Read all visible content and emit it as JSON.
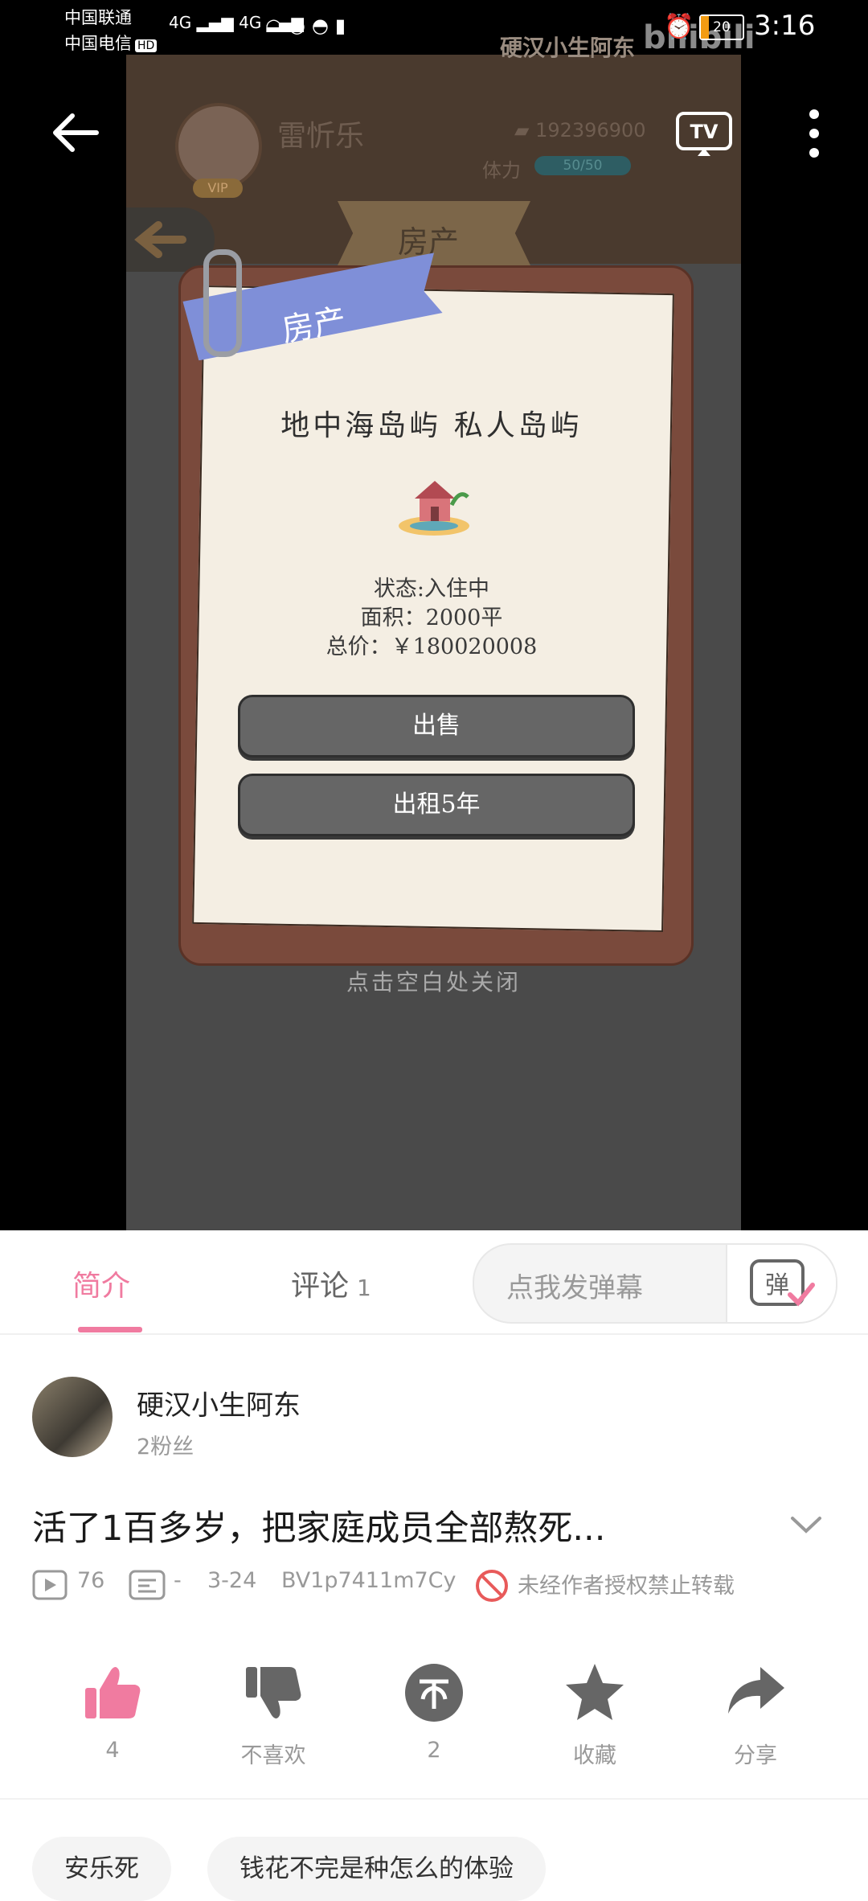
{
  "status_bar": {
    "carrier1": "中国联通",
    "carrier2": "中国电信",
    "hd": "HD",
    "network": "4G",
    "battery": "20",
    "time": "3:16"
  },
  "video": {
    "watermark_uploader": "硬汉小生阿东",
    "watermark_logo": "bilibili",
    "game": {
      "player_name": "雷忻乐",
      "vip": "VIP",
      "coins": "192396900",
      "stamina_label": "体力",
      "stamina_value": "50/50",
      "banner": "房产",
      "dialog": {
        "tag": "房产",
        "property_title": "地中海岛屿 私人岛屿",
        "status": "状态:入住中",
        "area": "面积：2000平",
        "price": "总价：￥180020008",
        "sell_button": "出售",
        "rent_button": "出租5年",
        "close_hint": "点击空白处关闭"
      }
    }
  },
  "tabs": {
    "intro": "简介",
    "comments": "评论",
    "comments_count": "1",
    "danmaku_placeholder": "点我发弹幕",
    "danmaku_button": "弹"
  },
  "uploader": {
    "name": "硬汉小生阿东",
    "fans": "2粉丝"
  },
  "video_info": {
    "title": "活了1百多岁，把家庭成员全部熬死...",
    "plays": "76",
    "danmaku_count": "-",
    "date": "3-24",
    "bvid": "BV1p7411m7Cy",
    "no_repost": "未经作者授权禁止转载"
  },
  "actions": {
    "like": "4",
    "dislike": "不喜欢",
    "coin": "2",
    "favorite": "收藏",
    "share": "分享"
  },
  "tags": [
    "安乐死",
    "钱花不完是种怎么的体验"
  ],
  "colors": {
    "accent": "#f07ba0",
    "video_bg": "#000000",
    "dialog_tag": "#7f8fd8"
  }
}
